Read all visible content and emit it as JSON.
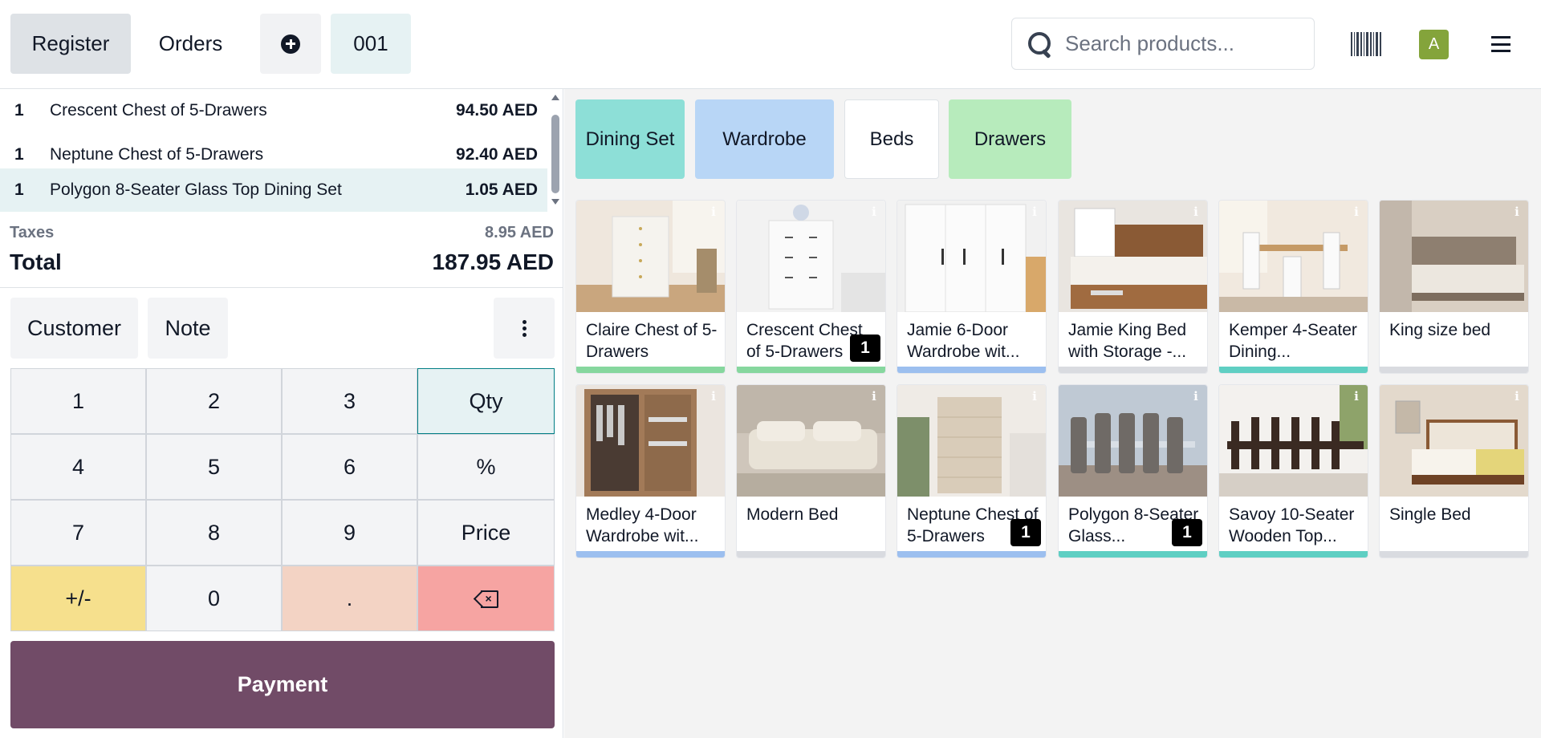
{
  "header": {
    "register_label": "Register",
    "orders_label": "Orders",
    "order_number": "001",
    "search_placeholder": "Search products...",
    "avatar_initial": "A"
  },
  "order": {
    "lines": [
      {
        "qty": "1",
        "name": "Crescent Chest of 5-Drawers",
        "price": "94.50 AED",
        "selected": false
      },
      {
        "qty": "1",
        "name": "Neptune Chest of 5-Drawers",
        "price": "92.40 AED",
        "selected": false
      },
      {
        "qty": "1",
        "name": "Polygon 8-Seater Glass Top Dining Set",
        "price": "1.05 AED",
        "selected": true
      }
    ],
    "taxes_label": "Taxes",
    "taxes_value": "8.95 AED",
    "total_label": "Total",
    "total_value": "187.95 AED"
  },
  "actions": {
    "customer_label": "Customer",
    "note_label": "Note"
  },
  "numpad": {
    "keys": [
      "1",
      "2",
      "3",
      "Qty",
      "4",
      "5",
      "6",
      "%",
      "7",
      "8",
      "9",
      "Price",
      "+/-",
      "0",
      "."
    ]
  },
  "payment_label": "Payment",
  "categories": [
    {
      "label": "Dining Set",
      "color": "#8ddfd7"
    },
    {
      "label": "Wardrobe",
      "color": "#b8d6f6"
    },
    {
      "label": "Beds",
      "color": "#ffffff"
    },
    {
      "label": "Drawers",
      "color": "#b7ebbc"
    }
  ],
  "products": [
    {
      "name": "Claire Chest of 5-Drawers",
      "bar": "#86d79e",
      "badge": ""
    },
    {
      "name": "Crescent Chest of 5-Drawers",
      "bar": "#86d79e",
      "badge": "1"
    },
    {
      "name": "Jamie 6-Door Wardrobe wit...",
      "bar": "#9cbfef",
      "badge": ""
    },
    {
      "name": "Jamie King Bed with Storage -...",
      "bar": "#d9dbe0",
      "badge": ""
    },
    {
      "name": "Kemper 4-Seater Dining...",
      "bar": "#5fcfc3",
      "badge": ""
    },
    {
      "name": "King size bed",
      "bar": "#d9dbe0",
      "badge": ""
    },
    {
      "name": "Medley 4-Door Wardrobe wit...",
      "bar": "#9cbfef",
      "badge": ""
    },
    {
      "name": "Modern Bed",
      "bar": "#d9dbe0",
      "badge": ""
    },
    {
      "name": "Neptune Chest of 5-Drawers",
      "bar": "#9cbfef",
      "badge": "1"
    },
    {
      "name": "Polygon 8-Seater Glass...",
      "bar": "#5fcfc3",
      "badge": "1"
    },
    {
      "name": "Savoy 10-Seater Wooden Top...",
      "bar": "#5fcfc3",
      "badge": ""
    },
    {
      "name": "Single Bed",
      "bar": "#d9dbe0",
      "badge": ""
    }
  ]
}
